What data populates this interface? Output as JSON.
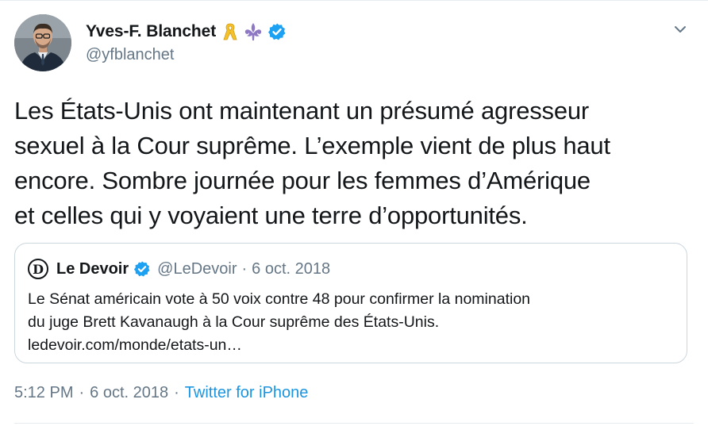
{
  "author": {
    "name": "Yves-F. Blanchet",
    "handle": "@yfblanchet",
    "emoji_icons": [
      "yellow-ribbon-icon",
      "fleur-de-lis-icon"
    ],
    "verified_icon": "verified-badge-icon"
  },
  "tweet": {
    "lines": [
      "Les États-Unis ont maintenant un présumé agresseur",
      "sexuel à la Cour suprême. L’exemple vient de plus haut",
      "encore. Sombre journée pour les femmes d’Amérique",
      "et celles qui y voyaient une terre d’opportunités."
    ]
  },
  "quoted": {
    "logo_letter": "D",
    "name": "Le Devoir",
    "handle": "@LeDevoir",
    "separator": "·",
    "date": "6 oct. 2018",
    "lines": [
      "Le Sénat américain vote à 50 voix contre 48 pour confirmer la nomination",
      "du juge Brett Kavanaugh à la Cour suprême des États-Unis.",
      "ledevoir.com/monde/etats-un…"
    ]
  },
  "footer": {
    "time": "5:12 PM",
    "sep1": "·",
    "date": "6 oct. 2018",
    "sep2": "·",
    "source": "Twitter for iPhone"
  },
  "colors": {
    "verified": "#1da1f2",
    "link": "#1b95e0",
    "secondary_text": "#657786",
    "border": "#ccd6dd"
  }
}
